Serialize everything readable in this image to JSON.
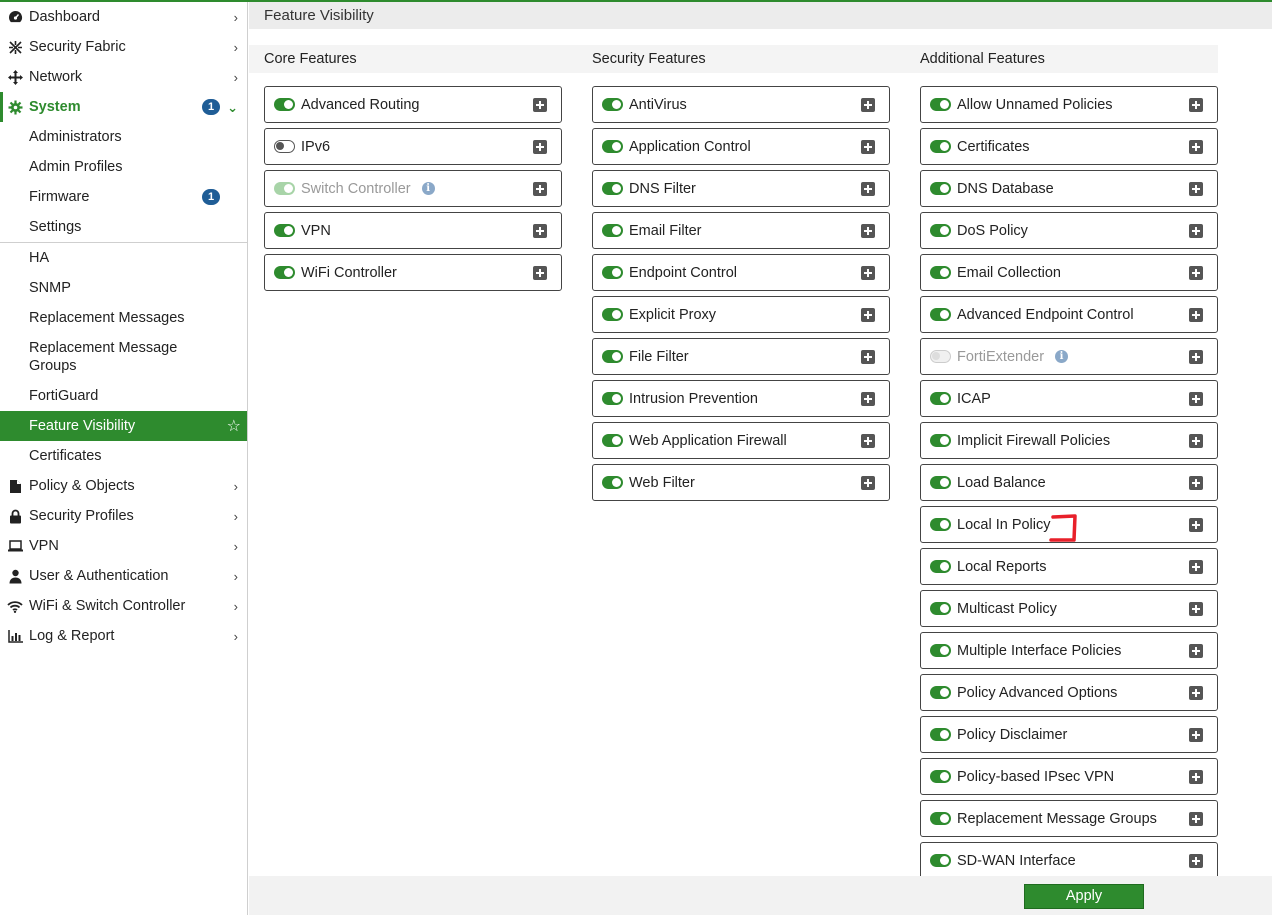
{
  "sidebar": {
    "top_items_before": [
      {
        "label": "Dashboard",
        "icon": "dashboard-icon"
      },
      {
        "label": "Security Fabric",
        "icon": "security-fabric-icon"
      },
      {
        "label": "Network",
        "icon": "network-icon"
      }
    ],
    "system": {
      "label": "System",
      "icon": "gear-icon",
      "badge": "1"
    },
    "system_subitems": [
      {
        "label": "Administrators"
      },
      {
        "label": "Admin Profiles"
      },
      {
        "label": "Firmware",
        "badge": "1"
      },
      {
        "label": "Settings"
      },
      {
        "label": "HA"
      },
      {
        "label": "SNMP"
      },
      {
        "label": "Replacement Messages"
      },
      {
        "label": "Replacement Message Groups"
      },
      {
        "label": "FortiGuard"
      },
      {
        "label": "Feature Visibility"
      },
      {
        "label": "Certificates"
      }
    ],
    "top_items_after": [
      {
        "label": "Policy & Objects",
        "icon": "policy-icon"
      },
      {
        "label": "Security Profiles",
        "icon": "lock-icon"
      },
      {
        "label": "VPN",
        "icon": "laptop-icon"
      },
      {
        "label": "User & Authentication",
        "icon": "user-icon"
      },
      {
        "label": "WiFi & Switch Controller",
        "icon": "wifi-icon"
      },
      {
        "label": "Log & Report",
        "icon": "chart-icon"
      }
    ]
  },
  "page": {
    "title": "Feature Visibility"
  },
  "columns": {
    "core": {
      "header": "Core Features",
      "items": [
        {
          "label": "Advanced Routing",
          "state": "on"
        },
        {
          "label": "IPv6",
          "state": "off"
        },
        {
          "label": "Switch Controller",
          "state": "disabled-on",
          "info": true
        },
        {
          "label": "VPN",
          "state": "on"
        },
        {
          "label": "WiFi Controller",
          "state": "on"
        }
      ]
    },
    "security": {
      "header": "Security Features",
      "items": [
        {
          "label": "AntiVirus",
          "state": "on"
        },
        {
          "label": "Application Control",
          "state": "on"
        },
        {
          "label": "DNS Filter",
          "state": "on"
        },
        {
          "label": "Email Filter",
          "state": "on"
        },
        {
          "label": "Endpoint Control",
          "state": "on"
        },
        {
          "label": "Explicit Proxy",
          "state": "on"
        },
        {
          "label": "File Filter",
          "state": "on"
        },
        {
          "label": "Intrusion Prevention",
          "state": "on"
        },
        {
          "label": "Web Application Firewall",
          "state": "on"
        },
        {
          "label": "Web Filter",
          "state": "on"
        }
      ]
    },
    "additional": {
      "header": "Additional Features",
      "items": [
        {
          "label": "Allow Unnamed Policies",
          "state": "on"
        },
        {
          "label": "Certificates",
          "state": "on"
        },
        {
          "label": "DNS Database",
          "state": "on"
        },
        {
          "label": "DoS Policy",
          "state": "on"
        },
        {
          "label": "Email Collection",
          "state": "on"
        },
        {
          "label": "Advanced Endpoint Control",
          "state": "on"
        },
        {
          "label": "FortiExtender",
          "state": "disabled",
          "info": true
        },
        {
          "label": "ICAP",
          "state": "on"
        },
        {
          "label": "Implicit Firewall Policies",
          "state": "on"
        },
        {
          "label": "Load Balance",
          "state": "on"
        },
        {
          "label": "Local In Policy",
          "state": "on",
          "marked": true
        },
        {
          "label": "Local Reports",
          "state": "on"
        },
        {
          "label": "Multicast Policy",
          "state": "on"
        },
        {
          "label": "Multiple Interface Policies",
          "state": "on"
        },
        {
          "label": "Policy Advanced Options",
          "state": "on"
        },
        {
          "label": "Policy Disclaimer",
          "state": "on"
        },
        {
          "label": "Policy-based IPsec VPN",
          "state": "on"
        },
        {
          "label": "Replacement Message Groups",
          "state": "on"
        },
        {
          "label": "SD-WAN Interface",
          "state": "on"
        }
      ]
    }
  },
  "footer": {
    "apply_label": "Apply"
  },
  "colors": {
    "accent": "#2e8b2e",
    "badge": "#1f5d96",
    "annotation": "#e8202a"
  }
}
